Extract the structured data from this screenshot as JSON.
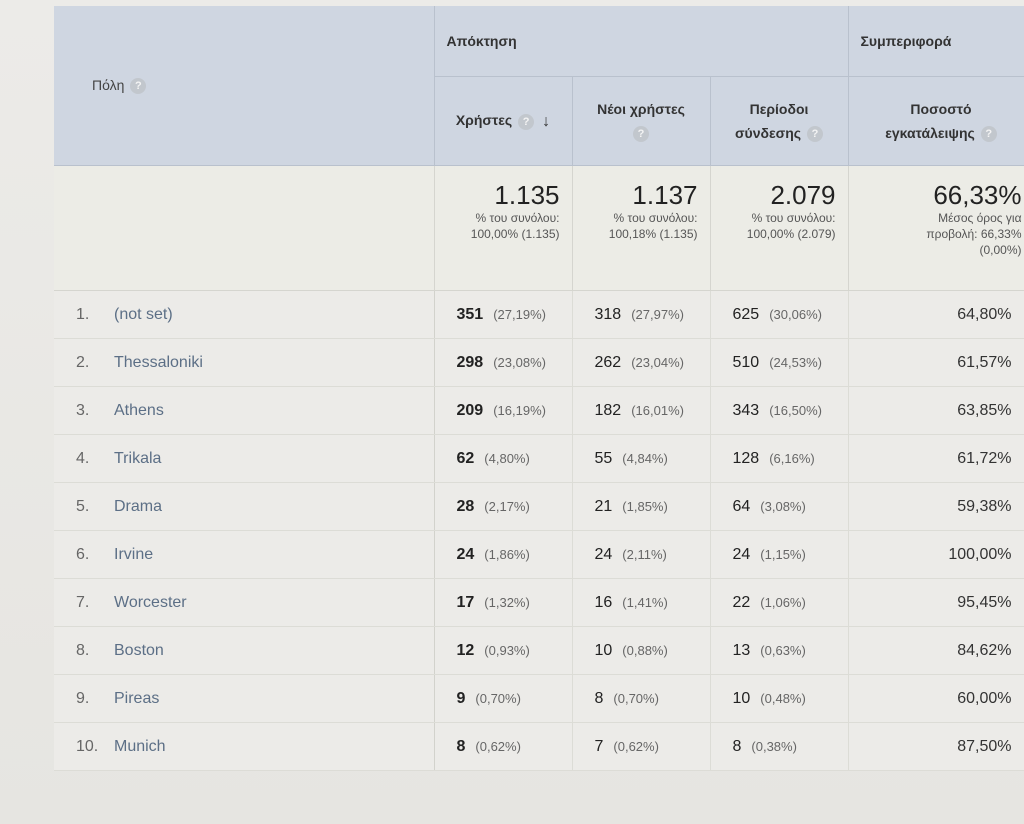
{
  "table": {
    "city_header": "Πόλη",
    "group_acquisition": "Απόκτηση",
    "group_behavior": "Συμπεριφορά",
    "col_users": "Χρήστες",
    "col_new_users": "Νέοι χρήστες",
    "col_sessions_l1": "Περίοδοι",
    "col_sessions_l2": "σύνδεσης",
    "col_bounce_l1": "Ποσοστό",
    "col_bounce_l2": "εγκατάλειψης",
    "help_glyph": "?",
    "sort_glyph": "↓"
  },
  "totals": {
    "users": {
      "value": "1.135",
      "line1": "% του συνόλου:",
      "line2": "100,00% (1.135)"
    },
    "new_users": {
      "value": "1.137",
      "line1": "% του συνόλου:",
      "line2": "100,18% (1.135)"
    },
    "sessions": {
      "value": "2.079",
      "line1": "% του συνόλου:",
      "line2": "100,00% (2.079)"
    },
    "bounce": {
      "value": "66,33%",
      "line1": "Μέσος όρος για",
      "line2": "προβολή: 66,33%",
      "line3": "(0,00%)"
    }
  },
  "rows": [
    {
      "n": "1.",
      "city": "(not set)",
      "users": "351",
      "users_pct": "(27,19%)",
      "new": "318",
      "new_pct": "(27,97%)",
      "sessions": "625",
      "sessions_pct": "(30,06%)",
      "bounce": "64,80%"
    },
    {
      "n": "2.",
      "city": "Thessaloniki",
      "users": "298",
      "users_pct": "(23,08%)",
      "new": "262",
      "new_pct": "(23,04%)",
      "sessions": "510",
      "sessions_pct": "(24,53%)",
      "bounce": "61,57%"
    },
    {
      "n": "3.",
      "city": "Athens",
      "users": "209",
      "users_pct": "(16,19%)",
      "new": "182",
      "new_pct": "(16,01%)",
      "sessions": "343",
      "sessions_pct": "(16,50%)",
      "bounce": "63,85%"
    },
    {
      "n": "4.",
      "city": "Trikala",
      "users": "62",
      "users_pct": "(4,80%)",
      "new": "55",
      "new_pct": "(4,84%)",
      "sessions": "128",
      "sessions_pct": "(6,16%)",
      "bounce": "61,72%"
    },
    {
      "n": "5.",
      "city": "Drama",
      "users": "28",
      "users_pct": "(2,17%)",
      "new": "21",
      "new_pct": "(1,85%)",
      "sessions": "64",
      "sessions_pct": "(3,08%)",
      "bounce": "59,38%"
    },
    {
      "n": "6.",
      "city": "Irvine",
      "users": "24",
      "users_pct": "(1,86%)",
      "new": "24",
      "new_pct": "(2,11%)",
      "sessions": "24",
      "sessions_pct": "(1,15%)",
      "bounce": "100,00%"
    },
    {
      "n": "7.",
      "city": "Worcester",
      "users": "17",
      "users_pct": "(1,32%)",
      "new": "16",
      "new_pct": "(1,41%)",
      "sessions": "22",
      "sessions_pct": "(1,06%)",
      "bounce": "95,45%"
    },
    {
      "n": "8.",
      "city": "Boston",
      "users": "12",
      "users_pct": "(0,93%)",
      "new": "10",
      "new_pct": "(0,88%)",
      "sessions": "13",
      "sessions_pct": "(0,63%)",
      "bounce": "84,62%"
    },
    {
      "n": "9.",
      "city": "Pireas",
      "users": "9",
      "users_pct": "(0,70%)",
      "new": "8",
      "new_pct": "(0,70%)",
      "sessions": "10",
      "sessions_pct": "(0,48%)",
      "bounce": "60,00%"
    },
    {
      "n": "10.",
      "city": "Munich",
      "users": "8",
      "users_pct": "(0,62%)",
      "new": "7",
      "new_pct": "(0,62%)",
      "sessions": "8",
      "sessions_pct": "(0,38%)",
      "bounce": "87,50%"
    }
  ]
}
